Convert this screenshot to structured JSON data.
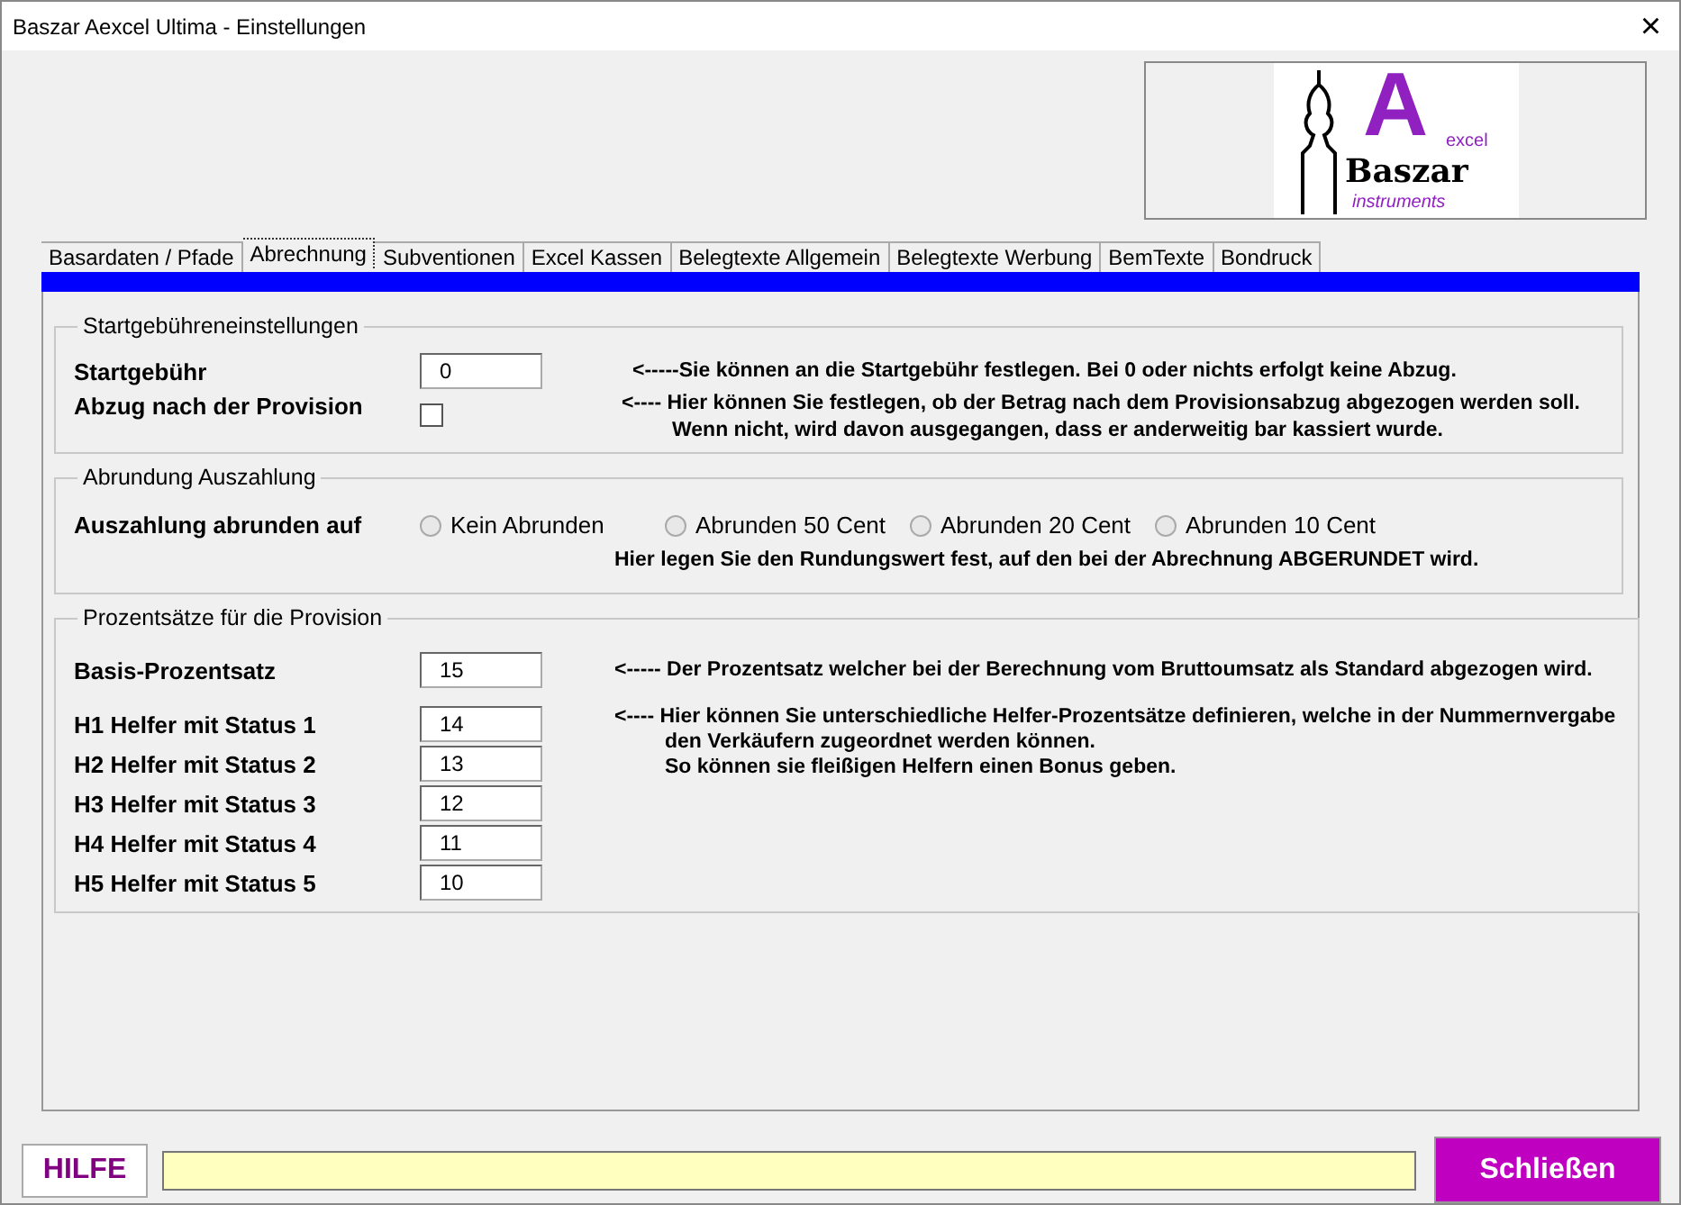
{
  "window": {
    "title": "Baszar Aexcel Ultima - Einstellungen",
    "close": "×"
  },
  "logo": {
    "letter": "A",
    "sub": "excel",
    "name": "Baszar",
    "tag": "instruments"
  },
  "tabs": [
    {
      "label": "Basardaten / Pfade",
      "selected": false
    },
    {
      "label": "Abrechnung",
      "selected": true
    },
    {
      "label": "Subventionen",
      "selected": false
    },
    {
      "label": "Excel Kassen",
      "selected": false
    },
    {
      "label": "Belegtexte Allgemein",
      "selected": false
    },
    {
      "label": "Belegtexte Werbung",
      "selected": false
    },
    {
      "label": "BemTexte",
      "selected": false
    },
    {
      "label": "Bondruck",
      "selected": false
    }
  ],
  "start_fee": {
    "title": "Startgebühreneinstellungen",
    "fee_label": "Startgebühr",
    "fee_value": "0",
    "fee_hint": "<-----Sie können an die Startgebühr festlegen. Bei 0 oder nichts erfolgt keine Abzug.",
    "deduct_label": "Abzug nach der Provision",
    "deduct_checked": false,
    "deduct_hint": [
      "<----  Hier können Sie festlegen, ob der Betrag nach dem Provisionsabzug abgezogen werden soll.",
      "Wenn nicht, wird davon ausgegangen, dass er anderweitig bar kassiert wurde."
    ]
  },
  "rounding": {
    "title": "Abrundung Auszahlung",
    "label": "Auszahlung abrunden auf",
    "options": [
      {
        "label": "Kein Abrunden",
        "selected": false
      },
      {
        "label": "Abrunden 50 Cent",
        "selected": false
      },
      {
        "label": "Abrunden 20 Cent",
        "selected": false
      },
      {
        "label": "Abrunden 10 Cent",
        "selected": false
      }
    ],
    "hint": "Hier legen Sie den Rundungswert fest, auf den bei der Abrechnung ABGERUNDET wird."
  },
  "commission": {
    "title": "Prozentsätze für die Provision",
    "base_label": "Basis-Prozentsatz",
    "base_value": "15",
    "base_hint": "<----- Der Prozentsatz welcher bei der Berechnung vom  Bruttoumsatz als Standard abgezogen wird.",
    "helpers": [
      {
        "label": "H1 Helfer mit Status 1",
        "value": "14"
      },
      {
        "label": "H2 Helfer mit Status 2",
        "value": "13"
      },
      {
        "label": "H3 Helfer mit Status 3",
        "value": "12"
      },
      {
        "label": "H4 Helfer mit Status 4",
        "value": "11"
      },
      {
        "label": "H5 Helfer mit Status 5",
        "value": "10"
      }
    ],
    "helper_hint": [
      "<----  Hier können Sie unterschiedliche Helfer-Prozentsätze definieren, welche in der Nummernvergabe",
      "den Verkäufern zugeordnet werden können.",
      "So können sie fleißigen Helfern einen Bonus geben."
    ]
  },
  "footer": {
    "help": "HILFE",
    "close": "Schließen"
  }
}
